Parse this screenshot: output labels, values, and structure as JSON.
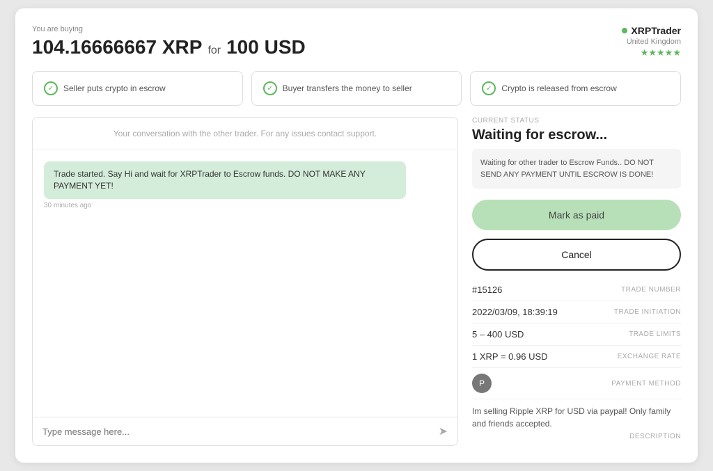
{
  "header": {
    "buying_label": "You are buying",
    "crypto_amount": "104.16666667 XRP",
    "for_text": "for",
    "fiat_amount": "100 USD"
  },
  "trader": {
    "name": "XRPTrader",
    "country": "United Kingdom",
    "stars": "★★★★★"
  },
  "steps": [
    {
      "label": "Seller puts crypto in escrow",
      "done": true
    },
    {
      "label": "Buyer transfers the money to seller",
      "done": true
    },
    {
      "label": "Crypto is released from escrow",
      "done": true
    }
  ],
  "chat": {
    "header_note": "Your conversation with the other trader. For any issues contact support.",
    "message": "Trade started. Say Hi and wait for XRPTrader to Escrow funds. DO NOT MAKE ANY PAYMENT YET!",
    "message_time": "30 minutes ago",
    "input_placeholder": "Type message here..."
  },
  "status": {
    "label": "CURRENT STATUS",
    "title": "Waiting for escrow...",
    "note": "Waiting for other trader to Escrow Funds.. DO NOT SEND ANY PAYMENT UNTIL ESCROW IS DONE!",
    "btn_mark_paid": "Mark as paid",
    "btn_cancel": "Cancel"
  },
  "trade_details": {
    "trade_number_value": "#15126",
    "trade_number_key": "TRADE NUMBER",
    "initiation_value": "2022/03/09, 18:39:19",
    "initiation_key": "TRADE INITIATION",
    "limits_value": "5 – 400 USD",
    "limits_key": "TRADE LIMITS",
    "exchange_rate_value": "1 XRP = 0.96 USD",
    "exchange_rate_key": "EXCHANGE RATE",
    "payment_method_key": "PAYMENT METHOD",
    "description_text": "Im selling Ripple XRP for USD via paypal! Only family and friends accepted.",
    "description_key": "DESCRIPTION"
  }
}
